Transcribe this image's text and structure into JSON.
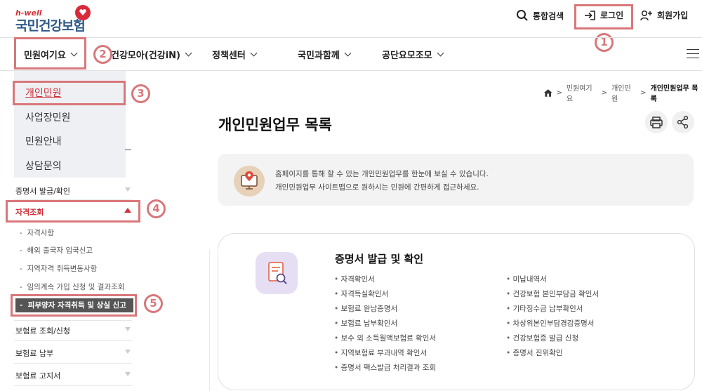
{
  "logo": {
    "small_text": "h-well",
    "main_text": "국민건강보험"
  },
  "utility": {
    "search_label": "통합검색",
    "login_label": "로그인",
    "join_label": "회원가입"
  },
  "gnb": {
    "items": [
      {
        "label": "민원여기요"
      },
      {
        "label": "건강모아(건강iN)"
      },
      {
        "label": "정책센터"
      },
      {
        "label": "국민과함께"
      },
      {
        "label": "공단요모조모"
      }
    ]
  },
  "dropdown": {
    "items": [
      {
        "label": "개인민원",
        "active": true
      },
      {
        "label": "사업장민원"
      },
      {
        "label": "민원안내"
      },
      {
        "label": "상담문의"
      }
    ]
  },
  "side_menu": {
    "cert": "증명서 발급/확인",
    "qualification": "자격조회",
    "sub_items": [
      "자격사항",
      "해외 출국자 입국신고",
      "지역자격 취득변동사항",
      "임의계속 가입 신청 및 결과조회"
    ],
    "active_sub_item": "피부양자 자격취득 및 상실 신고",
    "premium_inquiry": "보험료 조회/신청",
    "premium_payment": "보험료 납부",
    "premium_notice": "보험료 고지서"
  },
  "annotations": {
    "n1": "1",
    "n2": "2",
    "n3": "3",
    "n4": "4",
    "n5": "5"
  },
  "breadcrumb": {
    "level1": "민원여기요",
    "level2": "개인민원",
    "level3": "개인민원업무 목록"
  },
  "page_title": "개인민원업무 목록",
  "intro": {
    "line1": "홈페이지를 통해 할 수 있는 개인민원업무를 한눈에 보실 수 있습니다.",
    "line2": "개인민원업무 사이트맵으로 원하시는 민원에 간편하게 접근하세요."
  },
  "card": {
    "title": "증명서 발급 및 확인",
    "left_items": [
      "자격확인서",
      "자격득실확인서",
      "보험료 완납증명서",
      "보험료 납부확인서",
      "보수 외 소득월액보험료 확인서",
      "지역보험료 부과내역 확인서",
      "증명서 팩스발급 처리결과 조회"
    ],
    "right_items": [
      "미납내역서",
      "건강보험 본인부담금 확인서",
      "기타징수금 납부확인서",
      "차상위본인부담경감증명서",
      "건강보험증 발급 신청",
      "증명서 진위확인"
    ]
  },
  "colors": {
    "accent_red": "#d0313a",
    "annotation_red": "#d9777a",
    "logo_blue": "#2f5b8a"
  },
  "icons": [
    "search-icon",
    "login-icon",
    "join-icon",
    "home-icon",
    "print-icon",
    "share-icon",
    "menu-icon"
  ]
}
